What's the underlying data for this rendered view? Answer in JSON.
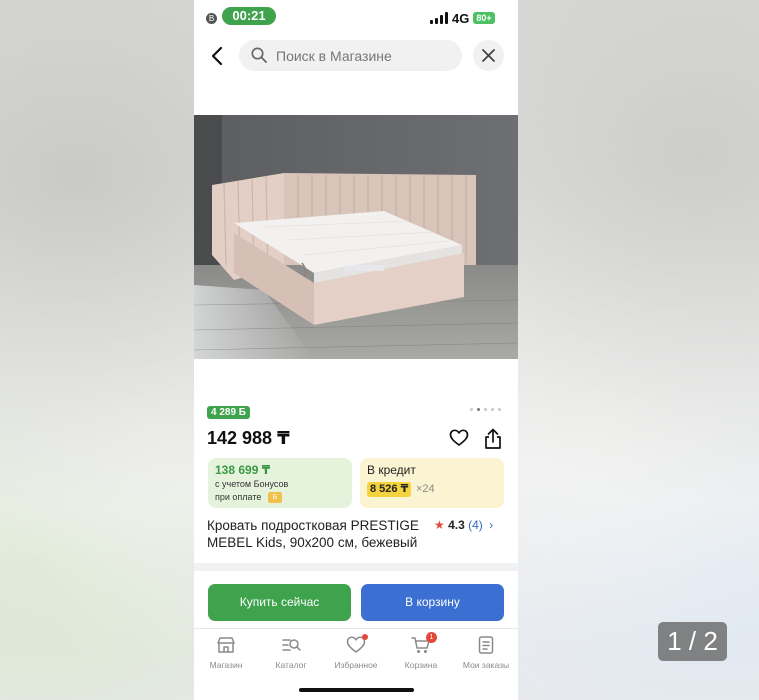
{
  "status_bar": {
    "time": "00:21",
    "network": "4G",
    "battery": "80+"
  },
  "search": {
    "placeholder": "Поиск в Магазине"
  },
  "product": {
    "bonus_badge": "4 289 Б",
    "price": "142 988 ₸",
    "bonus_card": {
      "amount": "138 699 ₸",
      "line1": "с учетом Бонусов",
      "line2": "при оплате",
      "coin": "Б"
    },
    "credit_card": {
      "label": "В кредит",
      "monthly": "8 526 ₸",
      "months": "×24"
    },
    "title": "Кровать подростковая PRESTIGE MEBEL Kids, 90x200 см, бежевый",
    "rating": {
      "value": "4.3",
      "count": "(4)"
    },
    "image_dots": {
      "total": 5,
      "active": 2
    }
  },
  "actions": {
    "buy_now": "Купить сейчас",
    "add_to_cart": "В корзину"
  },
  "tabbar": {
    "items": [
      {
        "label": "Магазин",
        "icon": "store-icon"
      },
      {
        "label": "Каталог",
        "icon": "catalog-search-icon"
      },
      {
        "label": "Избранное",
        "icon": "heart-icon"
      },
      {
        "label": "Корзина",
        "icon": "cart-icon",
        "badge": "1"
      },
      {
        "label": "Мои заказы",
        "icon": "orders-icon"
      }
    ]
  },
  "viewer": {
    "page_counter": "1 / 2"
  },
  "colors": {
    "green": "#3fa34d",
    "blue": "#3b6fd2",
    "bonus_bg": "#e5f3dd",
    "credit_bg": "#fbf4d3",
    "credit_highlight": "#f5d33d",
    "badge_red": "#e5483b"
  }
}
